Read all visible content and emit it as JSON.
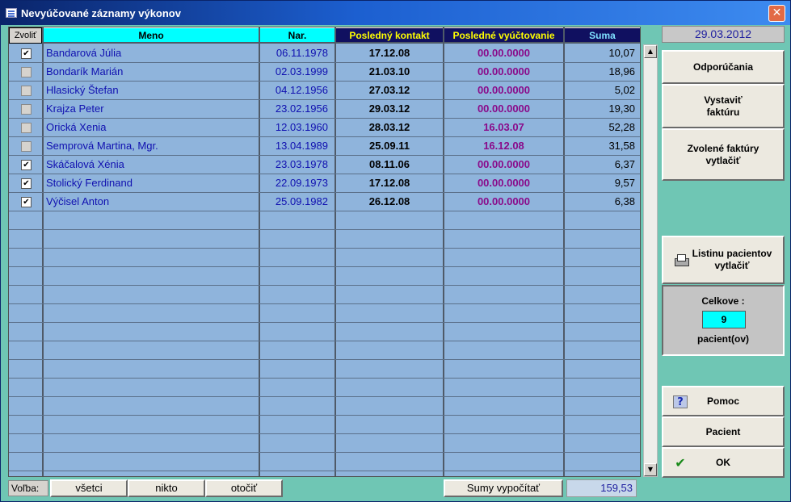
{
  "window": {
    "title": "Nevyúčované záznamy výkonov",
    "close_glyph": "✕"
  },
  "date": "29.03.2012",
  "table": {
    "headers": {
      "select": "Zvoliť",
      "name": "Meno",
      "dob": "Nar.",
      "last_contact": "Posledný kontakt",
      "last_billing": "Posledné vyúčtovanie",
      "sum": "Suma"
    },
    "rows": [
      {
        "checked": true,
        "name": "Bandarová Júlia",
        "dob": "06.11.1978",
        "last_contact": "17.12.08",
        "last_billing": "00.00.0000",
        "sum": "10,07"
      },
      {
        "checked": false,
        "name": "Bondarík Marián",
        "dob": "02.03.1999",
        "last_contact": "21.03.10",
        "last_billing": "00.00.0000",
        "sum": "18,96"
      },
      {
        "checked": false,
        "name": "Hlasický Štefan",
        "dob": "04.12.1956",
        "last_contact": "27.03.12",
        "last_billing": "00.00.0000",
        "sum": "5,02"
      },
      {
        "checked": false,
        "name": "Krajza Peter",
        "dob": "23.02.1956",
        "last_contact": "29.03.12",
        "last_billing": "00.00.0000",
        "sum": "19,30"
      },
      {
        "checked": false,
        "name": "Orická Xenia",
        "dob": "12.03.1960",
        "last_contact": "28.03.12",
        "last_billing": "16.03.07",
        "sum": "52,28"
      },
      {
        "checked": false,
        "name": "Semprová Martina, Mgr.",
        "dob": "13.04.1989",
        "last_contact": "25.09.11",
        "last_billing": "16.12.08",
        "sum": "31,58"
      },
      {
        "checked": true,
        "name": "Skáčalová Xénia",
        "dob": "23.03.1978",
        "last_contact": "08.11.06",
        "last_billing": "00.00.0000",
        "sum": "6,37"
      },
      {
        "checked": true,
        "name": "Stolický Ferdinand",
        "dob": "22.09.1973",
        "last_contact": "17.12.08",
        "last_billing": "00.00.0000",
        "sum": "9,57"
      },
      {
        "checked": true,
        "name": "Výčisel Anton",
        "dob": "25.09.1982",
        "last_contact": "26.12.08",
        "last_billing": "00.00.0000",
        "sum": "6,38"
      }
    ],
    "empty_rows": 14
  },
  "sidebar": {
    "recommendations": "Odporúčania",
    "issue_invoice": "Vystaviť\nfaktúru",
    "print_selected_invoices": "Zvolené faktúry\nvytlačiť",
    "print_patient_list": "Listinu pacientov\nvytlačiť",
    "total_label": "Celkove :",
    "total_count": "9",
    "total_unit": "pacient(ov)",
    "help": "Pomoc",
    "patient": "Pacient",
    "ok": "OK",
    "help_icon_glyph": "?",
    "ok_icon_glyph": "✔"
  },
  "bottom": {
    "selection_label": "Voľba:",
    "all": "všetci",
    "none": "nikto",
    "invert": "otočiť",
    "compute_sums": "Sumy vypočítať",
    "sum_total": "159,53"
  },
  "scrollbar": {
    "up_glyph": "▲",
    "down_glyph": "▼"
  },
  "colors": {
    "grid_bg": "#8fb4dc",
    "window_bg": "#6fc6b4",
    "header_cyan": "#00ffff",
    "header_navy": "#101060",
    "billing_text": "#8a0a8a"
  }
}
